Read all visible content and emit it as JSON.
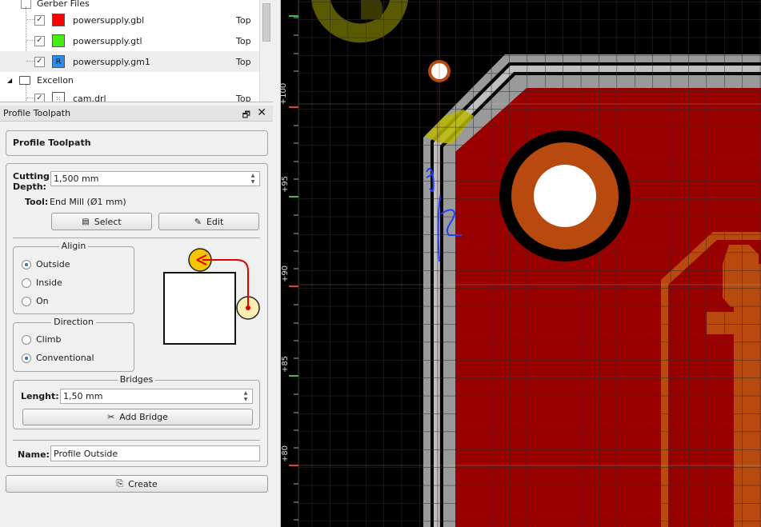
{
  "tree": {
    "gerber_group": "Gerber Files",
    "files": [
      {
        "name": "powersupply.gbl",
        "side": "Top",
        "color": "#ff0000",
        "glyph": ""
      },
      {
        "name": "powersupply.gtl",
        "side": "Top",
        "color": "#44ee11",
        "glyph": ""
      },
      {
        "name": "powersupply.gm1",
        "side": "Top",
        "color": "#2a8bf0",
        "glyph": "R"
      }
    ],
    "excellon_group": "Excellon",
    "drill_file": {
      "name": "cam.drl",
      "side": "Top"
    }
  },
  "dock": {
    "title": "Profile Toolpath",
    "float_icon": "float-window-icon",
    "close_icon": "close-icon"
  },
  "panel": {
    "header": "Profile Toolpath",
    "cutting_depth_label_1": "Cutting",
    "cutting_depth_label_2": "Depth:",
    "cutting_depth_value": "1,500 mm",
    "tool_label": "Tool:",
    "tool_value": "End Mill (Ø1 mm)",
    "select_label": "Select",
    "edit_label": "Edit",
    "align": {
      "title": "Aligin",
      "options": [
        "Outside",
        "Inside",
        "On"
      ],
      "selected": "Outside"
    },
    "direction": {
      "title": "Direction",
      "options": [
        "Climb",
        "Conventional"
      ],
      "selected": "Conventional"
    },
    "bridges": {
      "title": "Bridges",
      "length_label": "Lenght:",
      "length_value": "1,50 mm",
      "add_label": "Add Bridge"
    },
    "name_label": "Name:",
    "name_value": "Profile Outside",
    "create_label": "Create"
  },
  "canvas": {
    "ruler_labels": [
      "+100",
      "+95",
      "+90",
      "+85",
      "+80"
    ],
    "colors": {
      "background": "#000000",
      "copper": "#9a0000",
      "outline": "#a8a8a8",
      "trace": "#b84a10",
      "annotation": "#2040ff"
    }
  }
}
